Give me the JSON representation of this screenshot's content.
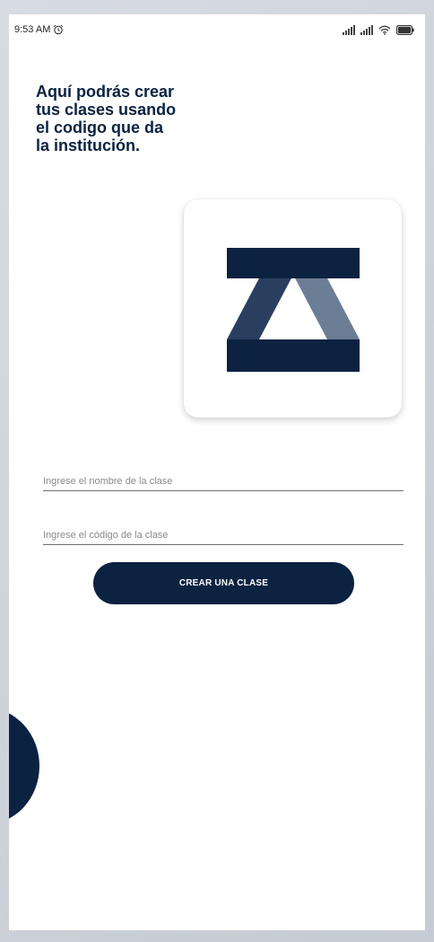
{
  "status_bar": {
    "time": "9:53 AM",
    "alarm_icon": "alarm-clock-icon",
    "signal_icon": "cellular-signal-icon",
    "wifi_icon": "wifi-icon",
    "battery_icon": "battery-icon"
  },
  "headline": {
    "lines": [
      "Aquí podrás crear",
      "tus clases usando",
      "el codigo que da",
      "la institución."
    ]
  },
  "logo": {
    "icon": "institution-logo",
    "colors": {
      "dark": "#0b2241",
      "mid": "#2a3f5f",
      "light": "#6c7d96"
    }
  },
  "form": {
    "class_name_placeholder": "Ingrese el nombre de la clase",
    "class_code_placeholder": "Ingrese el código de la clase",
    "submit_label": "CREAR UNA CLASE"
  },
  "navigation": {
    "back_icon": "arrow-left-icon"
  },
  "colors": {
    "primary": "#0b2241",
    "background": "#ffffff"
  }
}
